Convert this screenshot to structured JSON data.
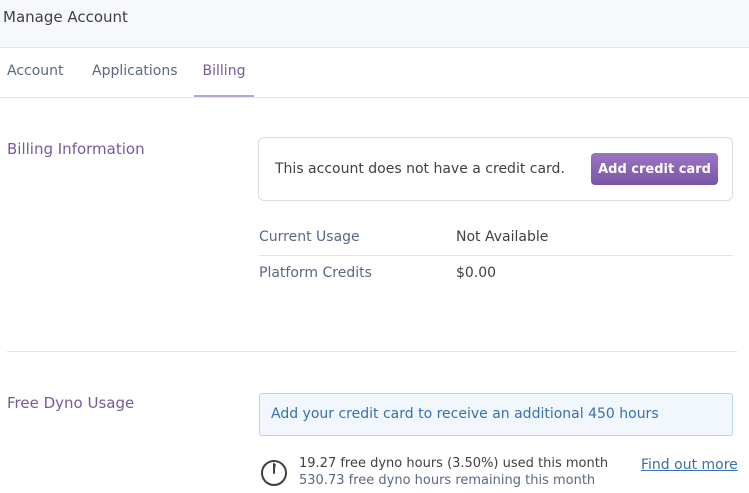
{
  "header": {
    "title": "Manage Account"
  },
  "tabs": [
    {
      "label": "Account"
    },
    {
      "label": "Applications"
    },
    {
      "label": "Billing"
    }
  ],
  "billing": {
    "section_label": "Billing Information",
    "no_card_message": "This account does not have a credit card.",
    "add_card_label": "Add credit card",
    "rows": [
      {
        "key": "Current Usage",
        "value": "Not Available"
      },
      {
        "key": "Platform Credits",
        "value": "$0.00"
      }
    ]
  },
  "dyno": {
    "section_label": "Free Dyno Usage",
    "notice": "Add your credit card to receive an additional 450 hours",
    "used_text": "19.27 free dyno hours (3.50%) used this month",
    "remaining_text": "530.73 free dyno hours remaining this month",
    "find_more_label": "Find out more",
    "used_fraction": 0.035
  },
  "colors": {
    "accent": "#79589f",
    "button": "#8a64b3",
    "link": "#3670b0"
  }
}
